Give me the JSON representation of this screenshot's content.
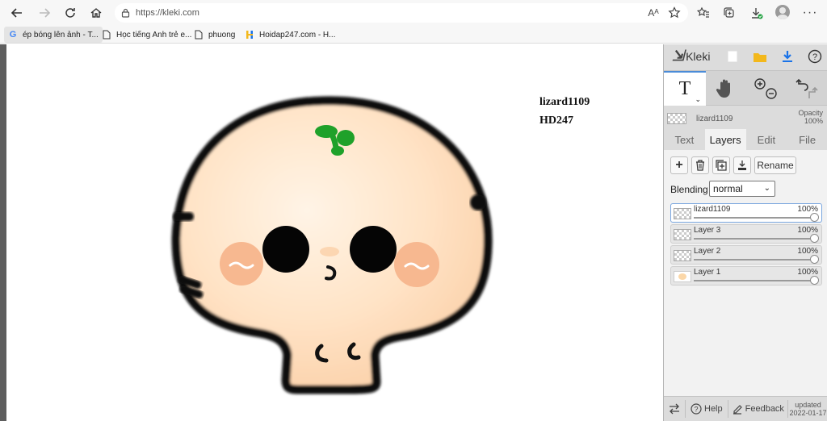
{
  "browser": {
    "url": "https://kleki.com",
    "read_aloud_label": "Aᴬ",
    "bookmarks": [
      {
        "label": "ép bóng lên ảnh - T...",
        "icon": "google-icon"
      },
      {
        "label": "Học tiếng Anh trẻ e...",
        "icon": "page-icon"
      },
      {
        "label": "phuong",
        "icon": "page-icon"
      },
      {
        "label": "Hoidap247.com - H...",
        "icon": "hoidap-icon"
      }
    ]
  },
  "canvas": {
    "text_line1": "lizard1109",
    "text_line2": "HD247"
  },
  "panel": {
    "logo_text": "Kleki",
    "tool_text_glyph": "T",
    "current_layer_name": "lizard1109",
    "opacity_label": "Opacity",
    "opacity_value": "100%",
    "tabs": [
      {
        "label": "Text",
        "active": false
      },
      {
        "label": "Layers",
        "active": true
      },
      {
        "label": "Edit",
        "active": false
      },
      {
        "label": "File",
        "active": false
      }
    ],
    "rename_label": "Rename",
    "blending_label": "Blending",
    "blending_value": "normal",
    "layers": [
      {
        "name": "lizard1109",
        "opacity": "100%",
        "active": true
      },
      {
        "name": "Layer 3",
        "opacity": "100%",
        "active": false
      },
      {
        "name": "Layer 2",
        "opacity": "100%",
        "active": false
      },
      {
        "name": "Layer 1",
        "opacity": "100%",
        "active": false
      }
    ],
    "footer": {
      "help_label": "Help",
      "feedback_label": "Feedback",
      "updated_label": "updated",
      "updated_date": "2022-01-17"
    }
  },
  "colors": {
    "accent_blue": "#4a8bd8",
    "sprout_green": "#1fa12a",
    "face_fill": "#ffe3c6",
    "cheek": "#f7b890",
    "folder_yellow": "#f3b81c",
    "download_blue": "#1a73e8"
  }
}
